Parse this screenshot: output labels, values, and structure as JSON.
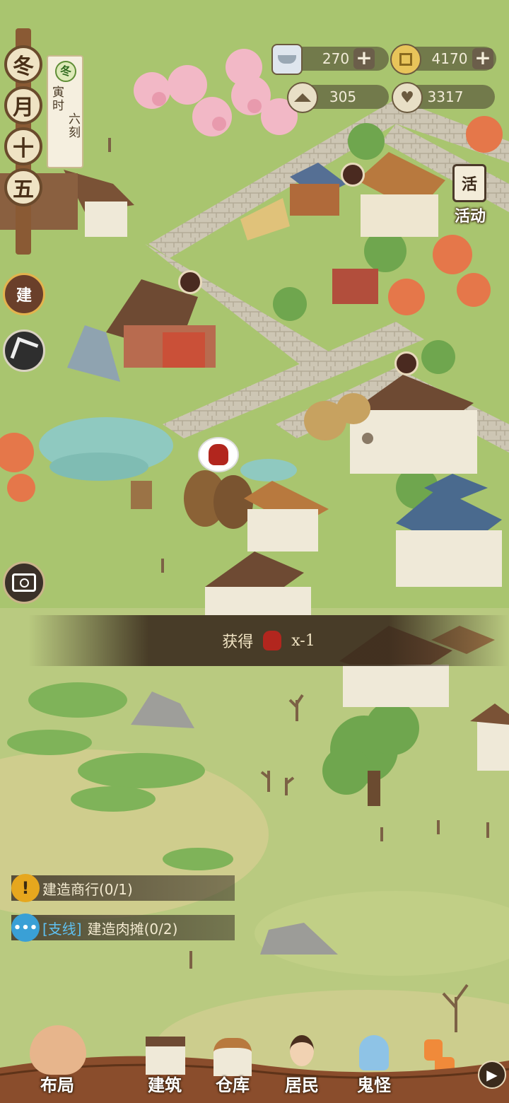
{
  "colors": {
    "grass": "#a8c46e",
    "road": "#c9c2b0",
    "roof_brown": "#7a5236",
    "roof_blue": "#4a6a8e",
    "accent": "#3aa0d6",
    "warn": "#e6a71e"
  },
  "resources": {
    "silver": {
      "icon": "silver-ingot-icon",
      "value": "270"
    },
    "coin": {
      "icon": "copper-coin-icon",
      "value": "4170"
    },
    "population": {
      "icon": "house-icon",
      "value": "305"
    },
    "prosperity": {
      "icon": "heart-icon",
      "value": "3317"
    }
  },
  "date": {
    "season": "冬",
    "month": "月",
    "day1": "十",
    "day2": "五",
    "tag": "冬",
    "time1": "寅",
    "time2": "时",
    "time3": "六",
    "time4": "刻"
  },
  "left_buttons": {
    "build_label": "建",
    "camera_icon": "camera-icon"
  },
  "event_button": {
    "label": "活动",
    "icon_text": "活"
  },
  "toast": {
    "prefix": "获得",
    "item_icon": "wine-jar-icon",
    "suffix": "x-1"
  },
  "quests": [
    {
      "icon": "exclamation-icon",
      "text": "建造商行(0/1)"
    },
    {
      "icon": "ellipsis-icon",
      "tag": "[支线]",
      "text": "建造肉摊(0/2)"
    }
  ],
  "bottom_nav": [
    {
      "label": "布局",
      "icon": "layout-pig-icon"
    },
    {
      "label": "建筑",
      "icon": "building-icon"
    },
    {
      "label": "仓库",
      "icon": "warehouse-icon"
    },
    {
      "label": "居民",
      "icon": "resident-icon"
    },
    {
      "label": "鬼怪",
      "icon": "ghost-icon"
    }
  ]
}
